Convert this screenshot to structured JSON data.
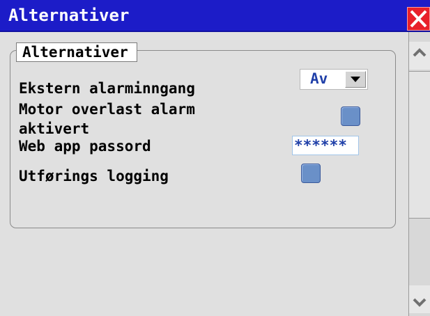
{
  "window": {
    "title": "Alternativer",
    "close_icon": "close-x-icon"
  },
  "group": {
    "legend": "Alternativer"
  },
  "options": {
    "external_alarm_label": "Ekstern alarminngang",
    "external_alarm_value": "Av",
    "motor_overload_label_line1": "Motor overlast alarm",
    "motor_overload_label_line2": "aktivert",
    "motor_overload_checked": false,
    "web_password_label": "Web app passord",
    "web_password_value": "******",
    "execution_logging_label": "Utførings logging",
    "execution_logging_checked": false
  },
  "colors": {
    "titlebar": "#1c1cc8",
    "close_button": "#e8202a",
    "checkbox": "#6a90c8",
    "value_text": "#1f3fa8"
  }
}
